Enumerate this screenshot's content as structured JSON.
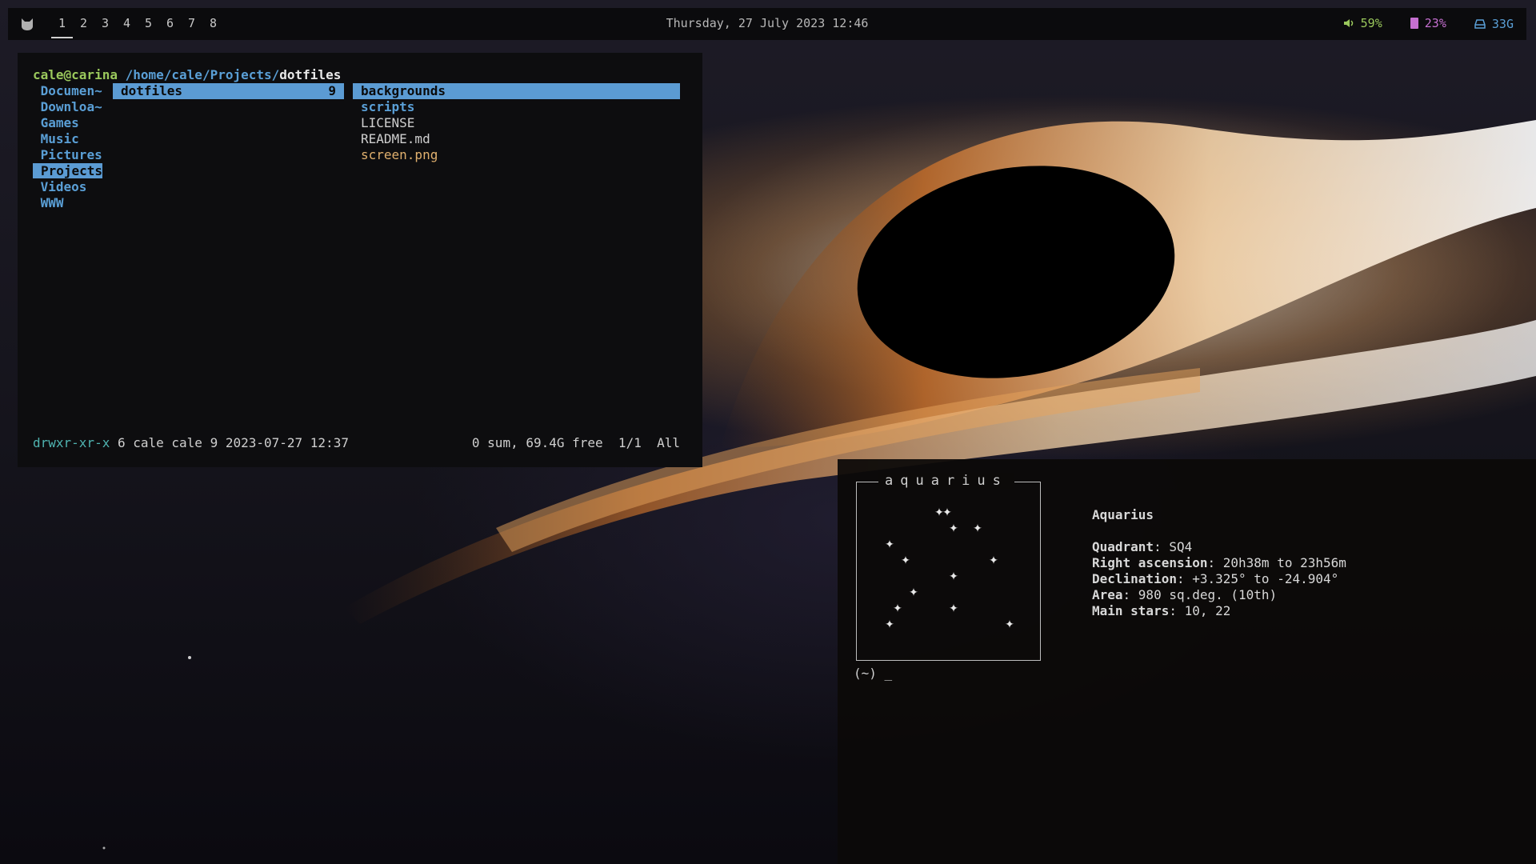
{
  "bar": {
    "workspaces": [
      "1",
      "2",
      "3",
      "4",
      "5",
      "6",
      "7",
      "8"
    ],
    "active_workspace": "1",
    "clock": "Thursday, 27 July 2023 12:46",
    "volume": "59%",
    "memory": "23%",
    "disk": "33G",
    "colors": {
      "volume": "#9ac85c",
      "memory": "#c56fd0",
      "disk": "#5a9fd6"
    }
  },
  "fm": {
    "user_host": "cale@carina",
    "path_prefix": "/home/cale/Projects/",
    "path_current": "dotfiles",
    "parent_items": [
      "Documen~",
      "Downloa~",
      "Games",
      "Music",
      "Pictures",
      "Projects",
      "Videos",
      "WWW"
    ],
    "current_dir": {
      "name": "dotfiles",
      "count": "9"
    },
    "preview_items": [
      {
        "name": "backgrounds",
        "type": "dir",
        "selected": true
      },
      {
        "name": "scripts",
        "type": "dir"
      },
      {
        "name": "LICENSE",
        "type": "file"
      },
      {
        "name": "README.md",
        "type": "file"
      },
      {
        "name": "screen.png",
        "type": "image"
      }
    ],
    "status": {
      "perms": "drwxr-xr-x",
      "meta": "6 cale cale 9 2023-07-27 12:37",
      "summary": "0 sum, 69.4G free  1/1  All"
    }
  },
  "term": {
    "constellation_title": "aquarius",
    "info_title": "Aquarius",
    "fields": [
      {
        "key": "Quadrant",
        "value": ": SQ4"
      },
      {
        "key": "Right ascension",
        "value": ": 20h38m to 23h56m"
      },
      {
        "key": "Declination",
        "value": ": +3.325° to -24.904°"
      },
      {
        "key": "Area",
        "value": ": 980 sq.deg. (10th)"
      },
      {
        "key": "Main stars",
        "value": ": 10, 22"
      }
    ],
    "prompt": "(~) _"
  }
}
